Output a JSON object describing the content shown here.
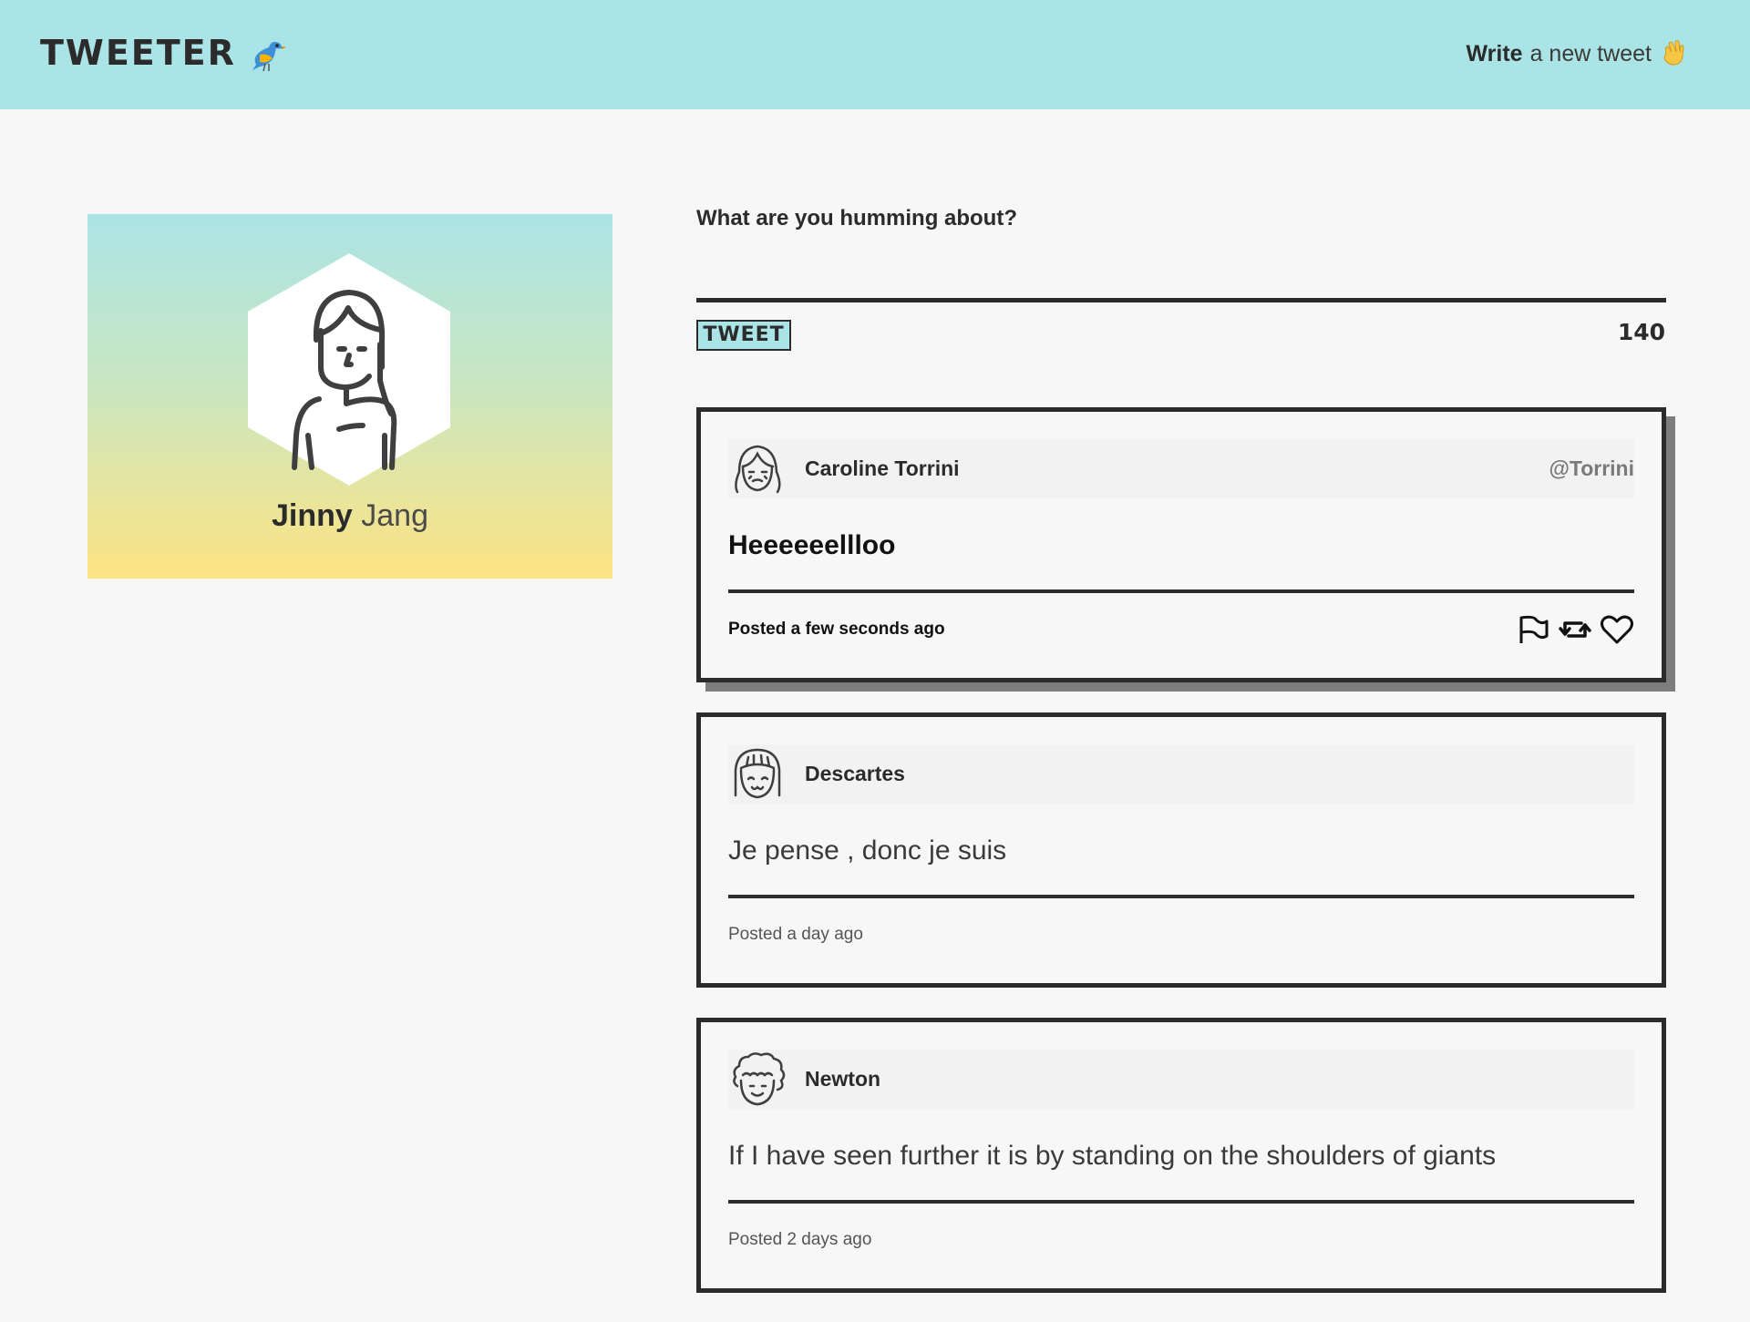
{
  "header": {
    "logo": "TWEETER",
    "logo_icon": "bird-emoji",
    "compose_bold": "Write",
    "compose_rest": "a new tweet",
    "compose_icon": "waving-hand-emoji"
  },
  "profile": {
    "first_name": "Jinny",
    "last_name": "Jang",
    "avatar_icon": "woman-avatar-icon"
  },
  "composer": {
    "label": "What are you humming about?",
    "input_value": "",
    "button_label": "TWEET",
    "counter": "140"
  },
  "tweets": [
    {
      "name": "Caroline Torrini",
      "handle": "@Torrini",
      "text": "Heeeeeellloo",
      "time": "Posted a few seconds ago",
      "avatar_icon": "girl-avatar-icon",
      "actions": [
        "flag-icon",
        "retweet-icon",
        "heart-icon"
      ]
    },
    {
      "name": "Descartes",
      "handle": "",
      "text": "Je pense , donc je suis",
      "time": "Posted a day ago",
      "avatar_icon": "bob-hair-avatar-icon"
    },
    {
      "name": "Newton",
      "handle": "",
      "text": "If I have seen further it is by standing on the shoulders of giants",
      "time": "Posted 2 days ago",
      "avatar_icon": "curly-hair-avatar-icon"
    }
  ],
  "colors": {
    "header_bg": "#abe4e6",
    "gradient_top": "#abe4e6",
    "gradient_bottom": "#fde483",
    "border": "#2b2b2b",
    "page_bg": "#f7f7f7"
  }
}
